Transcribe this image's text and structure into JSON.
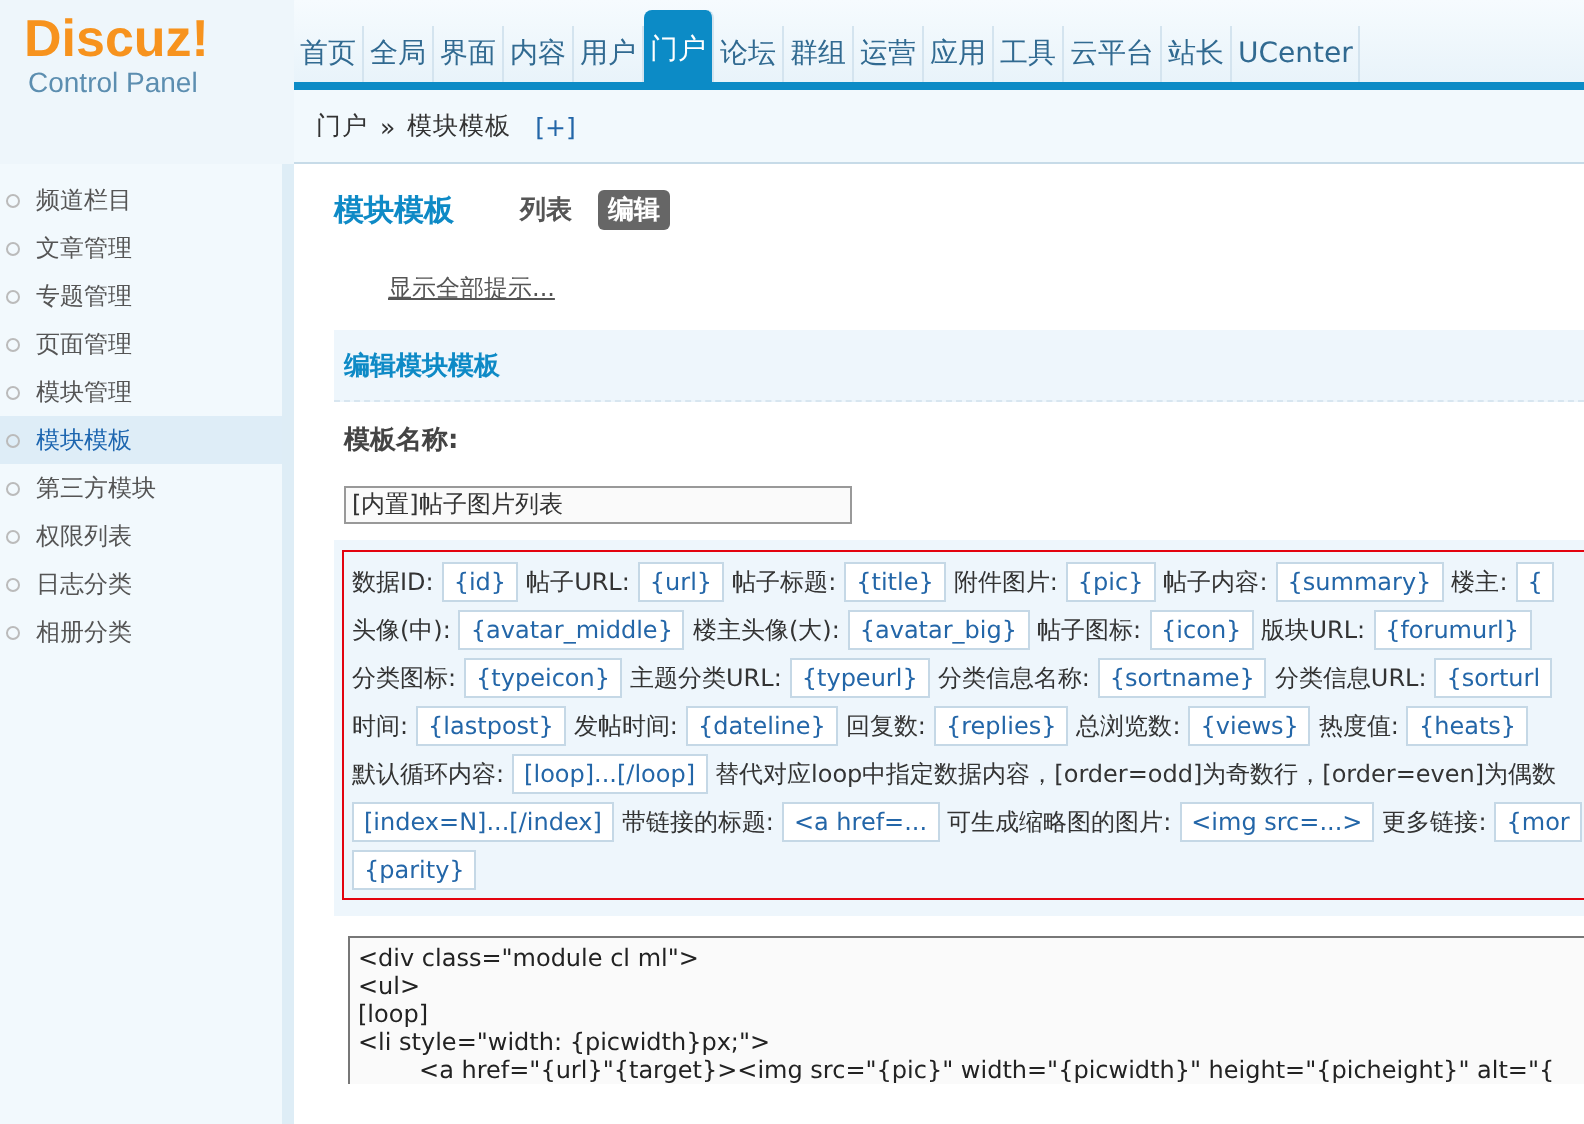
{
  "logo": {
    "name": "Discuz!",
    "subtitle": "Control Panel"
  },
  "nav": [
    {
      "label": "首页",
      "selected": false
    },
    {
      "label": "全局",
      "selected": false
    },
    {
      "label": "界面",
      "selected": false
    },
    {
      "label": "内容",
      "selected": false
    },
    {
      "label": "用户",
      "selected": false
    },
    {
      "label": "门户",
      "selected": true
    },
    {
      "label": "论坛",
      "selected": false
    },
    {
      "label": "群组",
      "selected": false
    },
    {
      "label": "运营",
      "selected": false
    },
    {
      "label": "应用",
      "selected": false
    },
    {
      "label": "工具",
      "selected": false
    },
    {
      "label": "云平台",
      "selected": false
    },
    {
      "label": "站长",
      "selected": false
    },
    {
      "label": "UCenter",
      "selected": false
    }
  ],
  "breadcrumb": {
    "parent": "门户",
    "separator": "»",
    "current": "模块模板",
    "add": "[+]"
  },
  "sidebar": {
    "items": [
      {
        "label": "频道栏目",
        "selected": false
      },
      {
        "label": "文章管理",
        "selected": false
      },
      {
        "label": "专题管理",
        "selected": false
      },
      {
        "label": "页面管理",
        "selected": false
      },
      {
        "label": "模块管理",
        "selected": false
      },
      {
        "label": "模块模板",
        "selected": true
      },
      {
        "label": "第三方模块",
        "selected": false
      },
      {
        "label": "权限列表",
        "selected": false
      },
      {
        "label": "日志分类",
        "selected": false
      },
      {
        "label": "相册分类",
        "selected": false
      }
    ]
  },
  "page": {
    "title": "模块模板",
    "tabs": [
      {
        "label": "列表",
        "selected": false
      },
      {
        "label": "编辑",
        "selected": true
      }
    ],
    "show_tips": "显示全部提示..."
  },
  "section": {
    "title": "编辑模块模板",
    "name_label": "模板名称:",
    "name_value": "[内置]帖子图片列表"
  },
  "tag_rows": [
    [
      {
        "kind": "label",
        "text": "数据ID:"
      },
      {
        "kind": "tag",
        "text": "{id}"
      },
      {
        "kind": "label",
        "text": "帖子URL:"
      },
      {
        "kind": "tag",
        "text": "{url}"
      },
      {
        "kind": "label",
        "text": "帖子标题:"
      },
      {
        "kind": "tag",
        "text": "{title}"
      },
      {
        "kind": "label",
        "text": "附件图片:"
      },
      {
        "kind": "tag",
        "text": "{pic}"
      },
      {
        "kind": "label",
        "text": "帖子内容:"
      },
      {
        "kind": "tag",
        "text": "{summary}"
      },
      {
        "kind": "label",
        "text": "楼主:"
      },
      {
        "kind": "tag",
        "text": "{"
      }
    ],
    [
      {
        "kind": "label",
        "text": "头像(中):"
      },
      {
        "kind": "tag",
        "text": "{avatar_middle}"
      },
      {
        "kind": "label",
        "text": "楼主头像(大):"
      },
      {
        "kind": "tag",
        "text": "{avatar_big}"
      },
      {
        "kind": "label",
        "text": "帖子图标:"
      },
      {
        "kind": "tag",
        "text": "{icon}"
      },
      {
        "kind": "label",
        "text": "版块URL:"
      },
      {
        "kind": "tag",
        "text": "{forumurl}"
      }
    ],
    [
      {
        "kind": "label",
        "text": "分类图标:"
      },
      {
        "kind": "tag",
        "text": "{typeicon}"
      },
      {
        "kind": "label",
        "text": "主题分类URL:"
      },
      {
        "kind": "tag",
        "text": "{typeurl}"
      },
      {
        "kind": "label",
        "text": "分类信息名称:"
      },
      {
        "kind": "tag",
        "text": "{sortname}"
      },
      {
        "kind": "label",
        "text": "分类信息URL:"
      },
      {
        "kind": "tag",
        "text": "{sorturl"
      }
    ],
    [
      {
        "kind": "label",
        "text": "时间:"
      },
      {
        "kind": "tag",
        "text": "{lastpost}"
      },
      {
        "kind": "label",
        "text": "发帖时间:"
      },
      {
        "kind": "tag",
        "text": "{dateline}"
      },
      {
        "kind": "label",
        "text": "回复数:"
      },
      {
        "kind": "tag",
        "text": "{replies}"
      },
      {
        "kind": "label",
        "text": "总浏览数:"
      },
      {
        "kind": "tag",
        "text": "{views}"
      },
      {
        "kind": "label",
        "text": "热度值:"
      },
      {
        "kind": "tag",
        "text": "{heats}"
      }
    ],
    [
      {
        "kind": "label",
        "text": "默认循环内容:"
      },
      {
        "kind": "tag",
        "text": "[loop]...[/loop]"
      },
      {
        "kind": "label",
        "text": "替代对应loop中指定数据内容，[order=odd]为奇数行，[order=even]为偶数"
      }
    ],
    [
      {
        "kind": "tag",
        "text": "[index=N]...[/index]"
      },
      {
        "kind": "label",
        "text": "带链接的标题:"
      },
      {
        "kind": "tag",
        "text": "<a href=..."
      },
      {
        "kind": "label",
        "text": "可生成缩略图的图片:"
      },
      {
        "kind": "tag",
        "text": "<img src=...>"
      },
      {
        "kind": "label",
        "text": "更多链接:"
      },
      {
        "kind": "tag",
        "text": "{mor"
      }
    ],
    [
      {
        "kind": "tag",
        "text": "{parity}"
      }
    ]
  ],
  "code_lines": [
    "<div class=\"module cl ml\">",
    "<ul>",
    "[loop]",
    "<li style=\"width: {picwidth}px;\">",
    "        <a href=\"{url}\"{target}><img src=\"{pic}\" width=\"{picwidth}\" height=\"{picheight}\" alt=\"{"
  ]
}
